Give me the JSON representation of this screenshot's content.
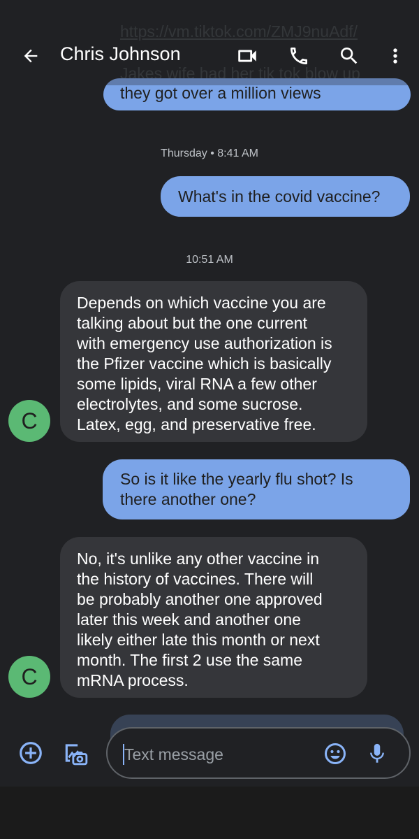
{
  "header": {
    "contact_name": "Chris Johnson",
    "icons": [
      "back-arrow-icon",
      "video-call-icon",
      "phone-icon",
      "search-icon",
      "more-vert-icon"
    ]
  },
  "messages": {
    "prev_link": "https://vm.tiktok.com/ZMJ9nuAdf/",
    "prev_text": "Jakes wife had her tik tok blow up",
    "prev_bubble_line": "they got over a million views",
    "timestamp_1": "Thursday • 8:41 AM",
    "out_1": "What's in the covid vaccine?",
    "timestamp_2": "10:51 AM",
    "in_1": {
      "avatar_letter": "C",
      "lines": [
        "Depends on which vaccine you are",
        "talking about but the one current",
        "with emergency use authorization is",
        "the Pfizer vaccine which is basically",
        "some lipids, viral RNA a few other",
        "electrolytes, and some sucrose.",
        "Latex, egg, and preservative free."
      ]
    },
    "out_2": {
      "lines": [
        "So is it like the yearly flu shot? Is",
        "there another one?"
      ]
    },
    "in_2": {
      "avatar_letter": "C",
      "lines": [
        "No, it's unlike any other vaccine in",
        "the history of vaccines. There will",
        "be probably another one approved",
        "later this week and another one",
        "likely either late this month or next",
        "month. The first 2 use the same",
        "mRNA process."
      ]
    }
  },
  "compose": {
    "placeholder": "Text message",
    "icons": [
      "add-circle-icon",
      "gallery-icon",
      "emoji-icon",
      "mic-icon"
    ]
  },
  "colors": {
    "background": "#202124",
    "outgoing_bubble": "#7ba4e8",
    "incoming_bubble": "#35363a",
    "avatar": "#5bb974",
    "accent": "#8ab4f8"
  }
}
